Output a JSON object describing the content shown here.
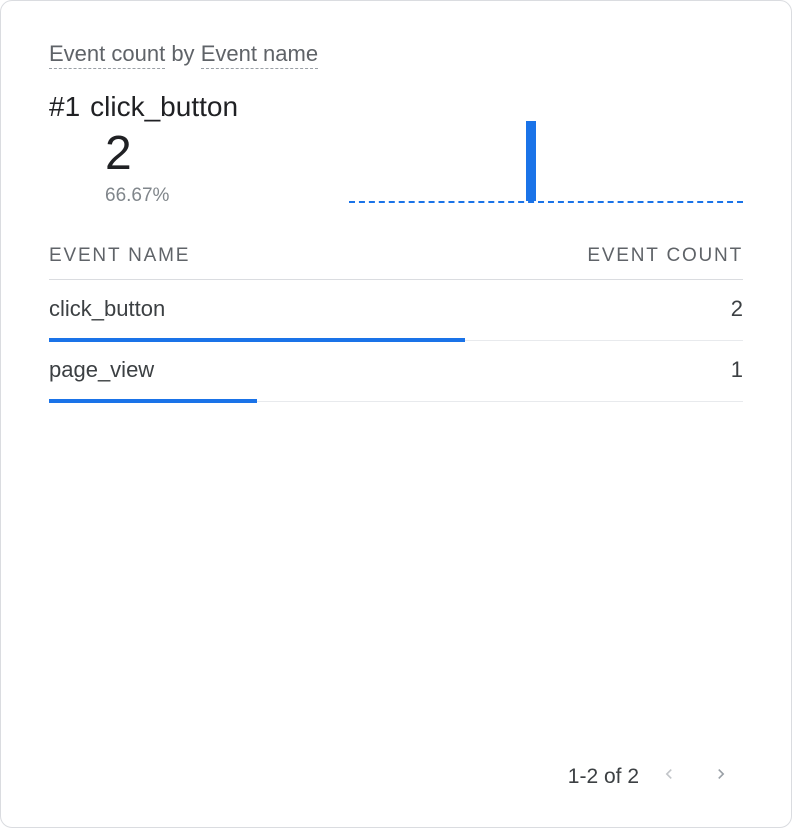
{
  "title": {
    "metric": "Event count",
    "by": "by",
    "dimension": "Event name"
  },
  "top": {
    "rank": "#1",
    "name": "click_button",
    "value": "2",
    "percent": "66.67%",
    "spark_left_pct": 45,
    "spark_height_pct": 100
  },
  "table": {
    "headers": {
      "name": "EVENT NAME",
      "count": "EVENT COUNT"
    },
    "rows": [
      {
        "name": "click_button",
        "count": "2",
        "bar_pct": 60
      },
      {
        "name": "page_view",
        "count": "1",
        "bar_pct": 30
      }
    ]
  },
  "pagination": {
    "label": "1-2 of 2"
  },
  "colors": {
    "accent": "#1a73e8"
  },
  "chart_data": {
    "type": "bar",
    "title": "Event count by Event name",
    "xlabel": "Event name",
    "ylabel": "Event count",
    "categories": [
      "click_button",
      "page_view"
    ],
    "values": [
      2,
      1
    ],
    "top_event": {
      "name": "click_button",
      "count": 2,
      "share_pct": 66.67
    }
  }
}
